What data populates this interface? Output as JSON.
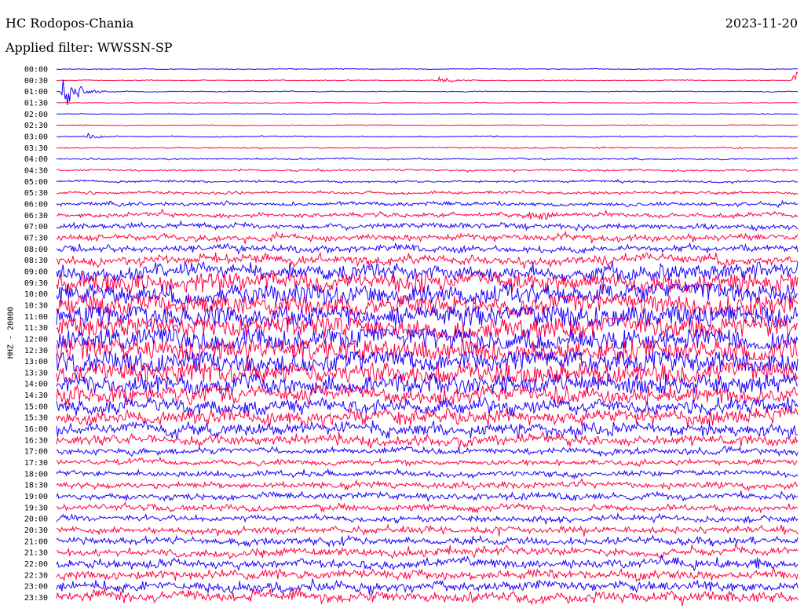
{
  "header": {
    "station": "HC Rodopos-Chania",
    "filter": "Applied filter: WWSSN-SP",
    "date": "2023-11-20"
  },
  "chart_data": {
    "type": "line",
    "subtype": "helicorder",
    "title": "HC Rodopos-Chania",
    "subtitle": "Applied filter: WWSSN-SP",
    "date": "2023-11-20",
    "ylabel": "HHZ - 20000",
    "xlabel": "",
    "grid": false,
    "legend": "none",
    "trace_minutes": 30,
    "colors": {
      "even_trace": "#1a00ff",
      "odd_trace": "#ff0040"
    },
    "row_labels": [
      "00:00",
      "00:30",
      "01:00",
      "01:30",
      "02:00",
      "02:30",
      "03:00",
      "03:30",
      "04:00",
      "04:30",
      "05:00",
      "05:30",
      "06:00",
      "06:30",
      "07:00",
      "07:30",
      "08:00",
      "08:30",
      "09:00",
      "09:30",
      "10:00",
      "10:30",
      "11:00",
      "11:30",
      "12:00",
      "12:30",
      "13:00",
      "13:30",
      "14:00",
      "14:30",
      "15:00",
      "15:30",
      "16:00",
      "16:30",
      "17:00",
      "17:30",
      "18:00",
      "18:30",
      "19:00",
      "19:30",
      "20:00",
      "20:30",
      "21:00",
      "21:30",
      "22:00",
      "22:30",
      "23:00",
      "23:30"
    ],
    "noise_amplitude": [
      0.12,
      0.1,
      0.12,
      0.12,
      0.1,
      0.12,
      0.16,
      0.18,
      0.22,
      0.28,
      0.3,
      0.4,
      0.55,
      0.65,
      0.75,
      0.85,
      0.95,
      1.3,
      2.2,
      3.0,
      3.2,
      3.4,
      3.5,
      3.4,
      3.5,
      3.6,
      3.4,
      3.2,
      2.8,
      2.4,
      2.2,
      2.0,
      1.8,
      1.4,
      0.9,
      0.7,
      0.8,
      0.9,
      0.95,
      0.9,
      0.85,
      0.95,
      1.0,
      1.1,
      1.2,
      1.3,
      1.4,
      1.5
    ],
    "events": [
      {
        "row": 2,
        "minute": 0.3,
        "amplitude": 3.0
      },
      {
        "row": 1,
        "minute": 15.5,
        "amplitude": 0.6
      },
      {
        "row": 1,
        "minute": 29.9,
        "amplitude": 2.5
      },
      {
        "row": 6,
        "minute": 1.2,
        "amplitude": 0.6
      },
      {
        "row": 13,
        "minute": 19.2,
        "amplitude": 1.3
      }
    ]
  }
}
